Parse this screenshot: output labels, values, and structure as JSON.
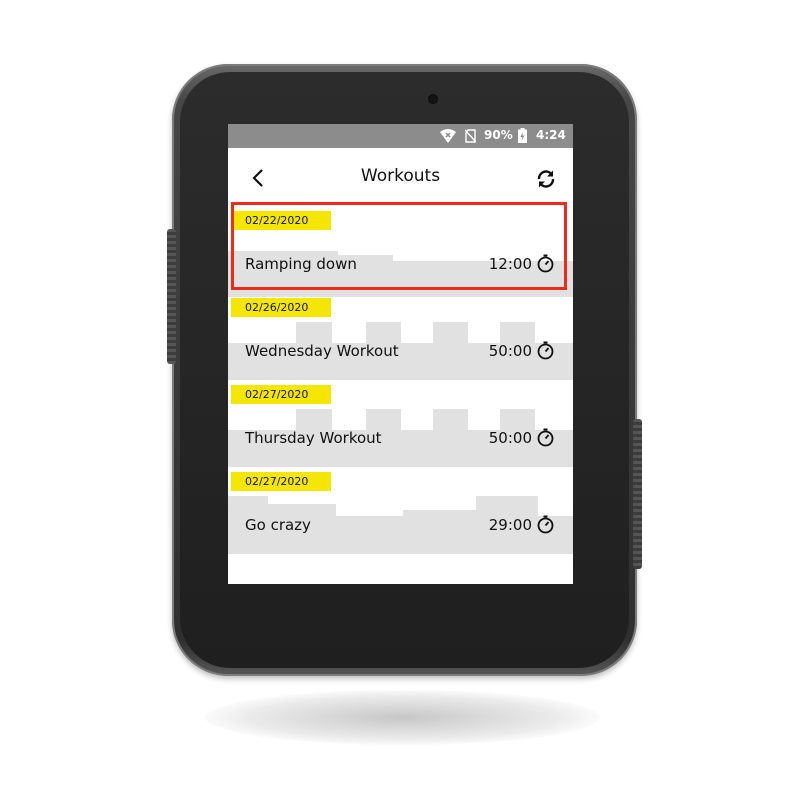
{
  "status_bar": {
    "battery": "90%",
    "time": "4:24"
  },
  "header": {
    "title": "Workouts"
  },
  "icons": {
    "back": "chevron-left-icon",
    "sync": "sync-icon",
    "timer": "stopwatch-icon",
    "wifi": "wifi-icon",
    "sim": "no-sim-icon",
    "battery": "battery-charging-icon"
  },
  "colors": {
    "date_badge": "#f5e600",
    "selection": "#ee2b17",
    "profile": "#e1e1e1",
    "status_bar": "#8c8c8c"
  },
  "workouts": [
    {
      "date": "02/22/2020",
      "name": "Ramping down",
      "duration": "12:00",
      "selected": true
    },
    {
      "date": "02/26/2020",
      "name": "Wednesday Workout",
      "duration": "50:00",
      "selected": false
    },
    {
      "date": "02/27/2020",
      "name": "Thursday Workout",
      "duration": "50:00",
      "selected": false
    },
    {
      "date": "02/27/2020",
      "name": "Go crazy",
      "duration": "29:00",
      "selected": false
    }
  ]
}
